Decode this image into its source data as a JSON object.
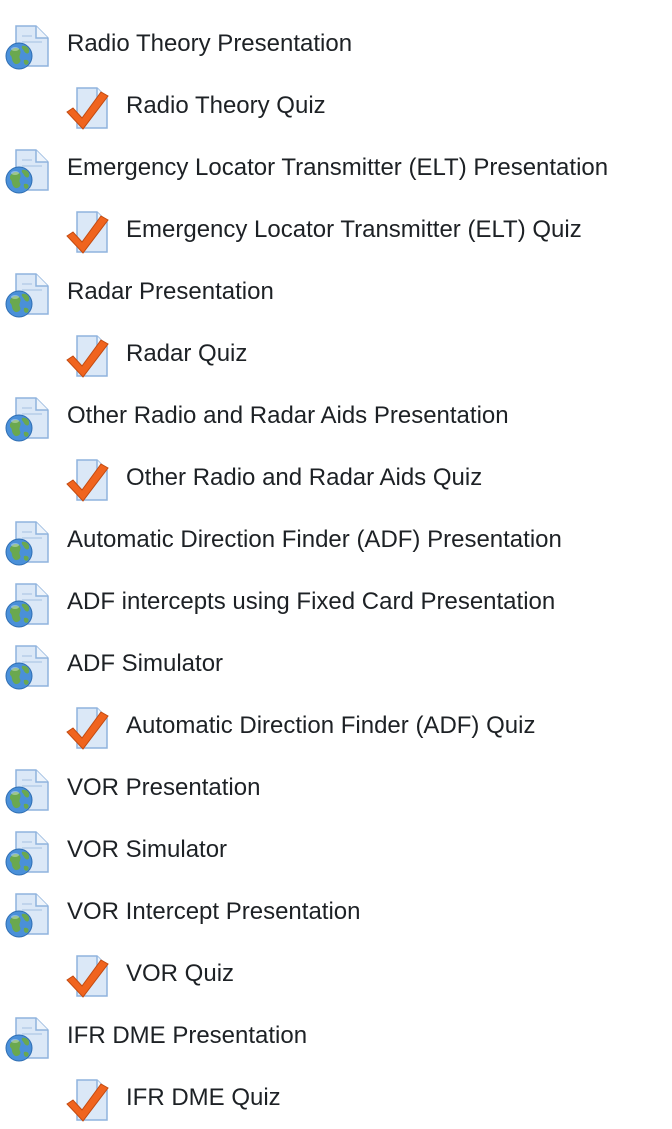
{
  "activities": [
    {
      "label": "Radio Theory Presentation",
      "type": "resource",
      "icon": "page-globe-icon"
    },
    {
      "label": "Radio Theory Quiz",
      "type": "quiz",
      "icon": "quiz-checkmark-icon"
    },
    {
      "label": "Emergency Locator Transmitter (ELT) Presentation",
      "type": "resource",
      "icon": "page-globe-icon"
    },
    {
      "label": "Emergency Locator Transmitter (ELT) Quiz",
      "type": "quiz",
      "icon": "quiz-checkmark-icon"
    },
    {
      "label": "Radar Presentation",
      "type": "resource",
      "icon": "page-globe-icon"
    },
    {
      "label": "Radar Quiz",
      "type": "quiz",
      "icon": "quiz-checkmark-icon"
    },
    {
      "label": "Other Radio and Radar Aids Presentation",
      "type": "resource",
      "icon": "page-globe-icon"
    },
    {
      "label": "Other Radio and Radar Aids Quiz",
      "type": "quiz",
      "icon": "quiz-checkmark-icon"
    },
    {
      "label": "Automatic Direction Finder (ADF) Presentation",
      "type": "resource",
      "icon": "page-globe-icon"
    },
    {
      "label": "ADF intercepts using Fixed Card Presentation",
      "type": "resource",
      "icon": "page-globe-icon"
    },
    {
      "label": "ADF Simulator",
      "type": "resource",
      "icon": "page-globe-icon"
    },
    {
      "label": "Automatic Direction Finder (ADF) Quiz",
      "type": "quiz",
      "icon": "quiz-checkmark-icon"
    },
    {
      "label": "VOR Presentation",
      "type": "resource",
      "icon": "page-globe-icon"
    },
    {
      "label": "VOR Simulator",
      "type": "resource",
      "icon": "page-globe-icon"
    },
    {
      "label": "VOR Intercept Presentation",
      "type": "resource",
      "icon": "page-globe-icon"
    },
    {
      "label": "VOR Quiz",
      "type": "quiz",
      "icon": "quiz-checkmark-icon"
    },
    {
      "label": "IFR DME Presentation",
      "type": "resource",
      "icon": "page-globe-icon"
    },
    {
      "label": "IFR DME Quiz",
      "type": "quiz",
      "icon": "quiz-checkmark-icon"
    }
  ],
  "colors": {
    "text": "#1d2125",
    "page_fill": "#dbe8f7",
    "page_stroke": "#8fb3dd",
    "globe_blue": "#4a90d9",
    "globe_green": "#6aa84f",
    "check_orange": "#f0641e"
  }
}
